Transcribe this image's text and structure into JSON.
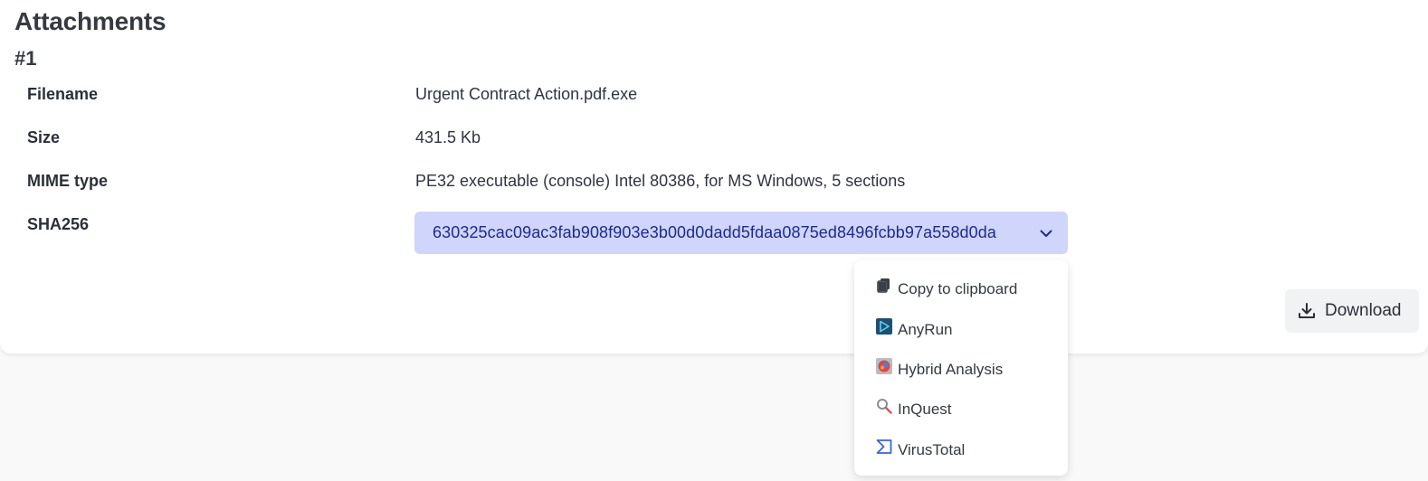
{
  "section": {
    "title": "Attachments"
  },
  "attachment": {
    "index": "#1",
    "fields": {
      "filename": {
        "label": "Filename",
        "value": "Urgent Contract Action.pdf.exe"
      },
      "size": {
        "label": "Size",
        "value": "431.5 Kb"
      },
      "mime": {
        "label": "MIME type",
        "value": "PE32 executable (console) Intel 80386, for MS Windows, 5 sections"
      },
      "sha256": {
        "label": "SHA256",
        "value": "630325cac09ac3fab908f903e3b00d0dadd5fdaa0875ed8496fcbb97a558d0da"
      }
    }
  },
  "hash_menu": {
    "items": [
      {
        "label": "Copy to clipboard",
        "icon": "copy-icon"
      },
      {
        "label": "AnyRun",
        "icon": "anyrun-icon"
      },
      {
        "label": "Hybrid Analysis",
        "icon": "hybrid-analysis-icon"
      },
      {
        "label": "InQuest",
        "icon": "inquest-icon"
      },
      {
        "label": "VirusTotal",
        "icon": "virustotal-icon"
      }
    ]
  },
  "actions": {
    "download_label": "Download",
    "download_icon": "download-icon"
  },
  "colors": {
    "hash_button_bg": "#cfd5fb",
    "hash_text": "#1f2a8c",
    "page_bg": "#f9f9f9"
  }
}
